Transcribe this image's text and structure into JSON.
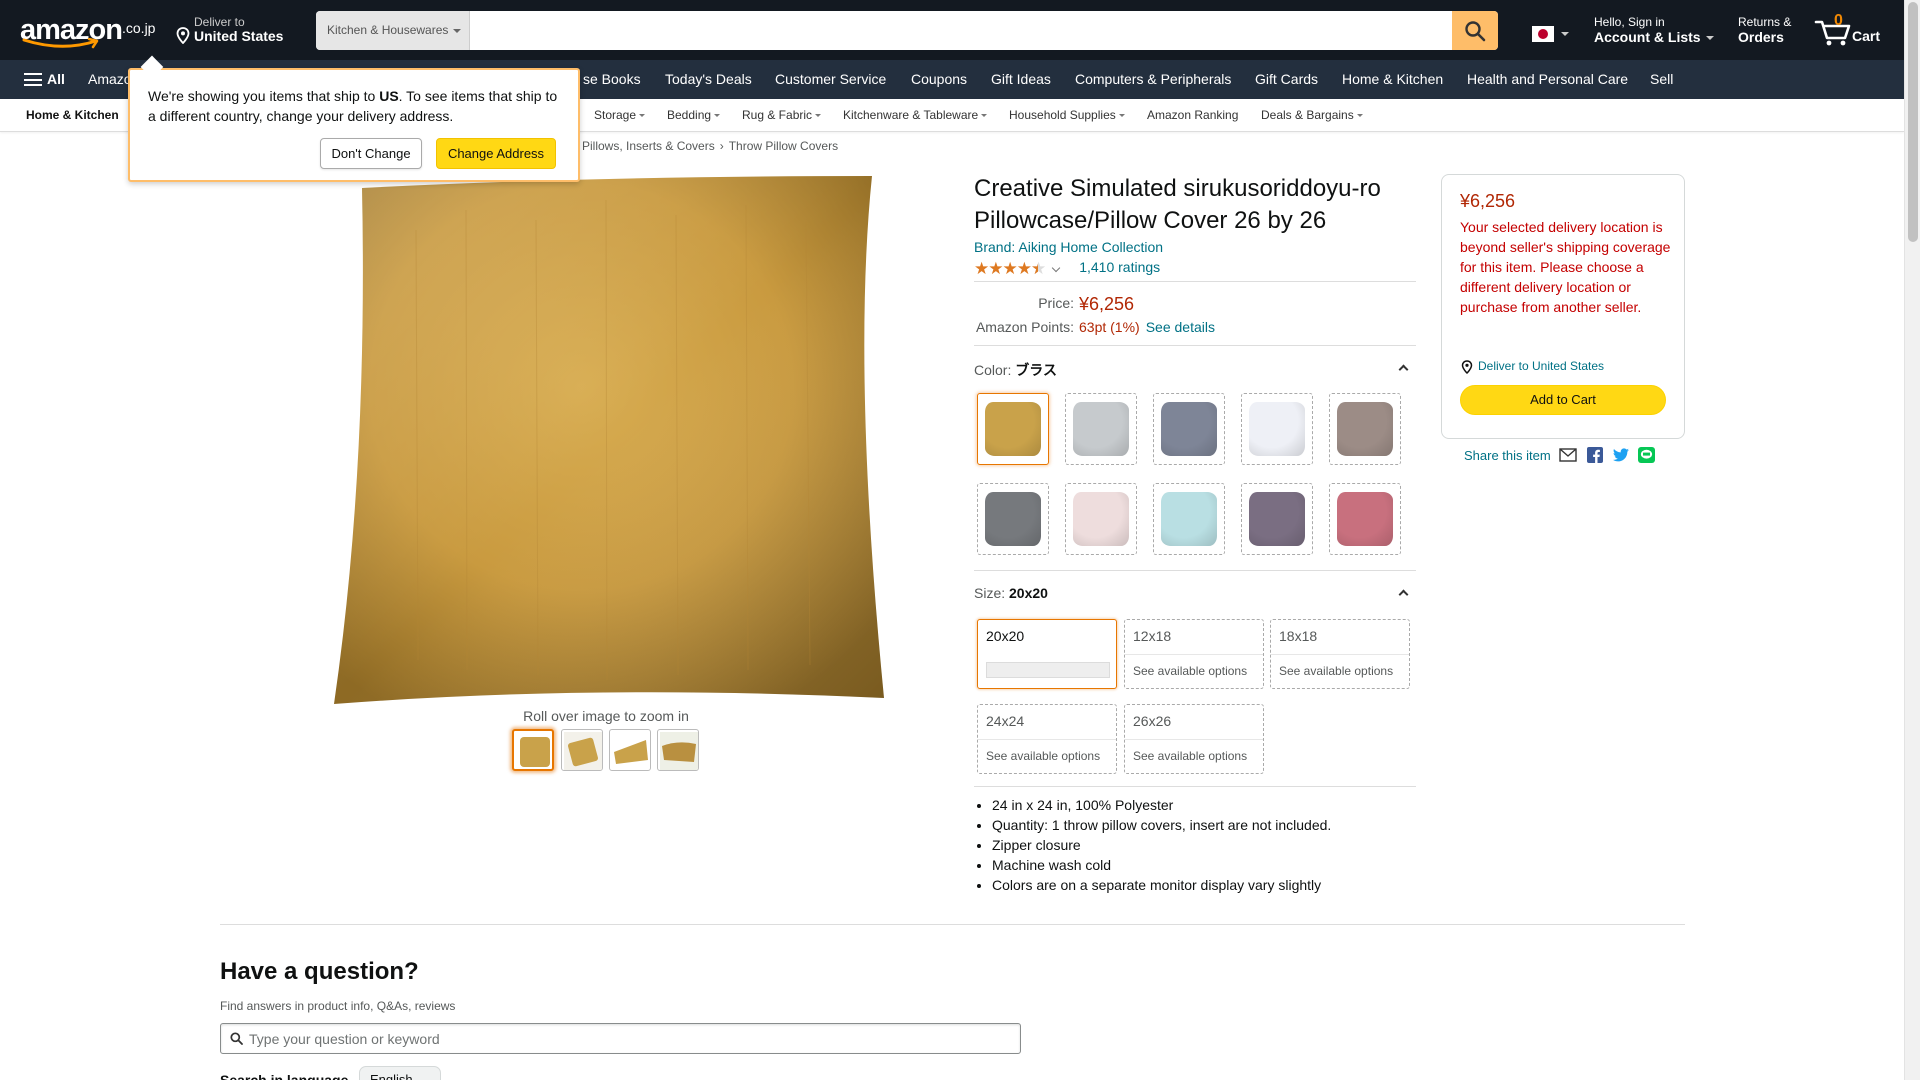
{
  "header": {
    "logo_text": "amazon",
    "logo_tld": ".co.jp",
    "deliver_line1": "Deliver to",
    "deliver_line2": "United States",
    "search_category": "Kitchen & Housewares",
    "search_placeholder": "",
    "account_line1": "Hello, Sign in",
    "account_line2": "Account & Lists",
    "returns_line1": "Returns &",
    "returns_line2": "Orders",
    "cart_count": "0",
    "cart_label": "Cart",
    "icons": [
      "location-pin-icon",
      "search-icon",
      "japan-flag-icon",
      "cart-icon"
    ]
  },
  "main_nav": {
    "all_label": "All",
    "items": [
      "Amazon",
      "se Books",
      "Today's Deals",
      "Customer Service",
      "Coupons",
      "Gift Ideas",
      "Computers & Peripherals",
      "Gift Cards",
      "Home & Kitchen",
      "Health and Personal Care",
      "Sell"
    ]
  },
  "sub_nav": {
    "items": [
      "Home & Kitchen",
      "Storage",
      "Bedding",
      "Rug & Fabric",
      "Kitchenware & Tableware",
      "Household Supplies",
      "Amazon Ranking",
      "Deals & Bargains"
    ]
  },
  "breadcrumb": [
    "Pillows, Inserts & Covers",
    "Throw Pillow Covers"
  ],
  "popover": {
    "msg_part1": "We're showing you items that ship to ",
    "msg_country": "US",
    "msg_part2": ". To see items that ship to a different country, change your delivery address.",
    "dont_change": "Don't Change",
    "change_address": "Change Address"
  },
  "gallery": {
    "zoom_hint": "Roll over image to zoom in",
    "thumbnail_count": 4
  },
  "product": {
    "title": "Creative Simulated sirukusoriddoyu-ro Pillowcase/Pillow Cover 26 by 26",
    "brand": "Brand: Aiking Home Collection",
    "rating_value": 4.5,
    "rating_count": "1,410 ratings",
    "price_label": "Price:",
    "price": "¥6,256",
    "points_label": "Amazon Points:",
    "points_value": "63pt",
    "points_pct": "(1%)",
    "points_link": "See details",
    "color_label": "Color:",
    "color_value": "ブラス",
    "size_label": "Size:",
    "size_value": "20x20",
    "color_swatches": [
      "#c9a24a",
      "#c6cacd",
      "#7e8597",
      "#eef0f6",
      "#9c8c86",
      "#76797d",
      "#eedddd",
      "#b9dfe3",
      "#7a6e82",
      "#c8707e"
    ],
    "sizes": [
      {
        "label": "20x20",
        "sub": ""
      },
      {
        "label": "12x18",
        "sub": "See available options"
      },
      {
        "label": "18x18",
        "sub": "See available options"
      },
      {
        "label": "24x24",
        "sub": "See available options"
      },
      {
        "label": "26x26",
        "sub": "See available options"
      }
    ],
    "bullets": [
      "24 in x 24 in, 100% Polyester",
      "Quantity: 1 throw pillow covers, insert are not included.",
      "Zipper closure",
      "Machine wash cold",
      "Colors are on a separate monitor display vary slightly"
    ]
  },
  "buybox": {
    "price": "¥6,256",
    "message": "Your selected delivery location is beyond seller's shipping coverage for this item. Please choose a different delivery location or purchase from another seller.",
    "deliver_link": "Deliver to United States",
    "add_to_cart": "Add to Cart",
    "share_label": "Share this item",
    "share_icons": [
      "email-icon",
      "facebook-icon",
      "twitter-icon",
      "line-icon"
    ]
  },
  "qa": {
    "title": "Have a question?",
    "subtitle": "Find answers in product info, Q&As, reviews",
    "placeholder": "Type your question or keyword",
    "lang_label": "Search in language",
    "lang_value": "English"
  },
  "colors": {
    "nav_dark": "#131921",
    "nav_secondary": "#232f3e",
    "search_button": "#febd69",
    "price_red": "#b12704",
    "link_teal": "#007185",
    "button_yellow": "#ffd814",
    "selected_orange": "#e77600"
  }
}
